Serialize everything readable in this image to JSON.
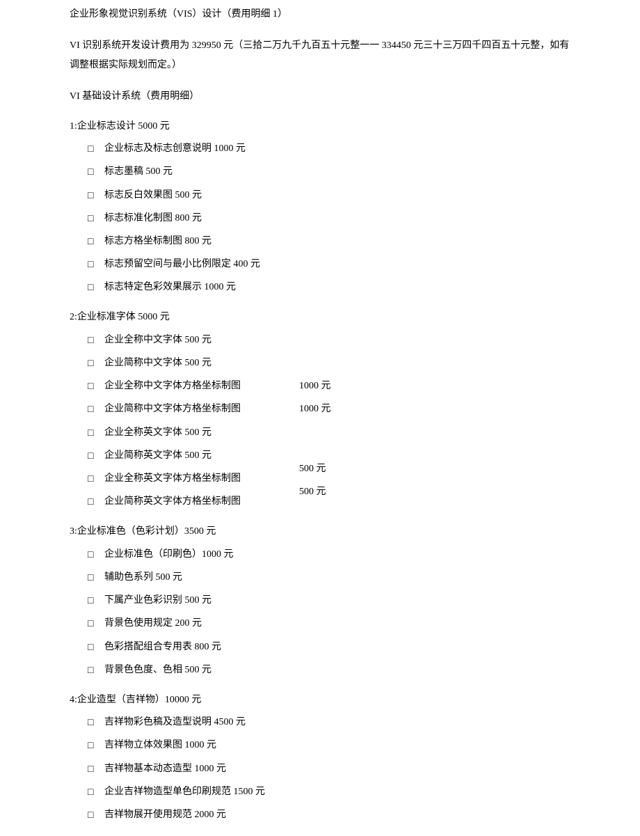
{
  "title": "企业形象视觉识别系统（VIS）设计（费用明细 1）",
  "intro": "VI 识别系统开发设计费用为 329950 元（三拾二万九千九百五十元整一一 334450 元三十三万四千四百五十元整，如有调整根据实际规划而定。）",
  "subtitle": "VI 基础设计系统（费用明细）",
  "checkbox": "□",
  "sections": [
    {
      "head": "1:企业标志设计 5000 元",
      "items": [
        {
          "text": "企业标志及标志创意说明 1000 元"
        },
        {
          "text": "标志墨稿 500 元"
        },
        {
          "text": "标志反白效果图 500 元"
        },
        {
          "text": "标志标准化制图 800 元"
        },
        {
          "text": "标志方格坐标制图 800 元"
        },
        {
          "text": "标志预留空间与最小比例限定 400 元"
        },
        {
          "text": "标志特定色彩效果展示 1000 元"
        }
      ]
    },
    {
      "head": "2:企业标准字体 5000 元",
      "items": [
        {
          "text": "企业全称中文字体 500 元"
        },
        {
          "text": "企业简称中文字体 500 元"
        },
        {
          "text": "企业全称中文字体方格坐标制图",
          "price": "1000  元"
        },
        {
          "text": "企业简称中文字体方格坐标制图",
          "price": "1000  元"
        },
        {
          "text": "企业全称英文字体 500 元"
        },
        {
          "text": "企业简称英文字体 500 元"
        },
        {
          "text": "企业全称英文字体方格坐标制图",
          "price": "500 元",
          "priceUp": true
        },
        {
          "text": "企业简称英文字体方格坐标制图",
          "price": "500 元",
          "priceUp": true
        }
      ]
    },
    {
      "head": "3:企业标准色（色彩计划）3500 元",
      "items": [
        {
          "text": "企业标准色（印刷色）1000 元"
        },
        {
          "text": "辅助色系列 500 元"
        },
        {
          "text": "下属产业色彩识别 500 元"
        },
        {
          "text": "背景色使用规定 200 元"
        },
        {
          "text": "色彩搭配组合专用表 800 元"
        },
        {
          "text": "背景色色度、色相 500 元"
        }
      ]
    },
    {
      "head": "4:企业造型（吉祥物）10000 元",
      "items": [
        {
          "text": "吉祥物彩色稿及造型说明 4500 元"
        },
        {
          "text": "吉祥物立体效果图 1000 元"
        },
        {
          "text": "吉祥物基本动态造型 1000 元"
        },
        {
          "text": "企业吉祥物造型单色印刷规范 1500 元"
        },
        {
          "text": "吉祥物展开使用规范 2000 元"
        }
      ]
    }
  ]
}
